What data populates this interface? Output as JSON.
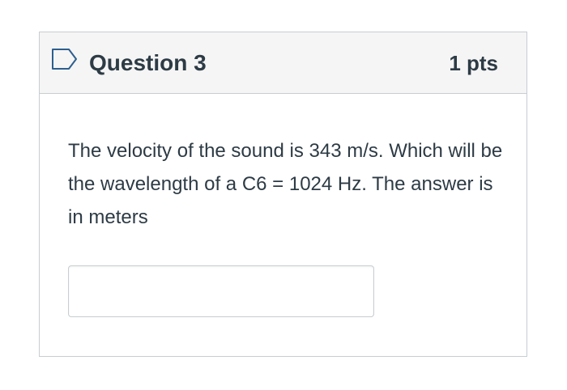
{
  "question": {
    "flag_icon": "bookmark-flag-icon",
    "title": "Question 3",
    "points": "1 pts",
    "text": "The velocity of the sound is 343 m/s. Which will be the wavelength of a C6 = 1024 Hz. The answer is in meters",
    "answer_value": "",
    "answer_placeholder": ""
  },
  "colors": {
    "header_background": "#f5f5f5",
    "border": "#c7cdd1",
    "text": "#2d3b45",
    "flag_stroke": "#2d5f8f"
  }
}
